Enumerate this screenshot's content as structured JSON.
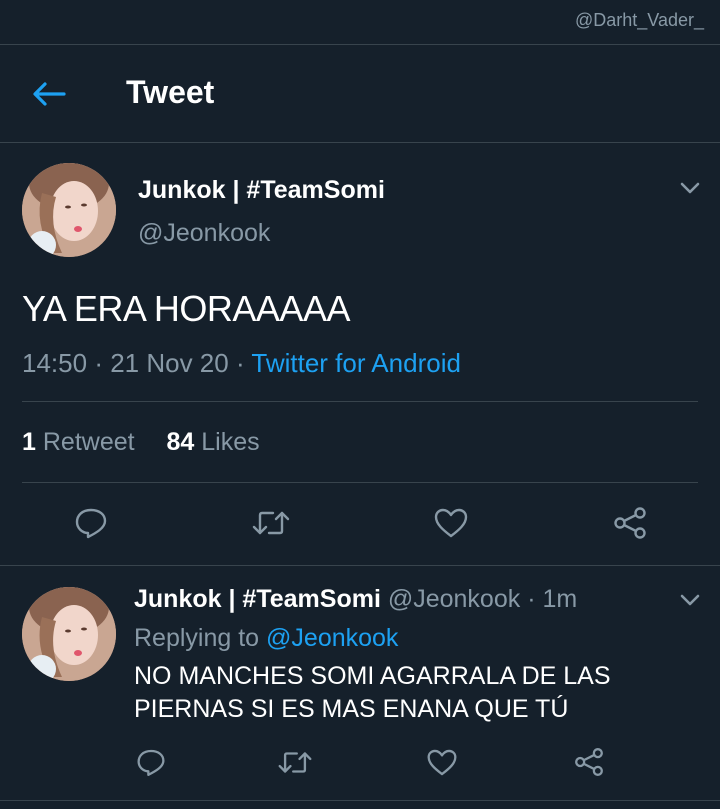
{
  "watermark": "@Darht_Vader_",
  "header": {
    "title": "Tweet"
  },
  "tweet": {
    "name": "Junkok | #TeamSomi",
    "handle": "@Jeonkook",
    "text": "YA ERA HORAAAAA",
    "time": "14:50",
    "date": "21 Nov 20",
    "source": "Twitter for Android",
    "retweets": "1",
    "retweets_label": "Retweet",
    "likes": "84",
    "likes_label": "Likes"
  },
  "reply": {
    "name": "Junkok | #TeamSomi",
    "handle": "@Jeonkook",
    "age": "1m",
    "replying_label": "Replying to",
    "replying_handle": "@Jeonkook",
    "text": "NO MANCHES SOMI AGARRALA DE LAS PIERNAS SI ES MAS ENANA QUE TÚ"
  },
  "colors": {
    "background": "#15202b",
    "accent": "#1da1f2",
    "muted": "#8899a6",
    "divider": "#38444d"
  },
  "icons": [
    "back-arrow-icon",
    "chevron-down-icon",
    "reply-icon",
    "retweet-icon",
    "like-icon",
    "share-icon"
  ]
}
